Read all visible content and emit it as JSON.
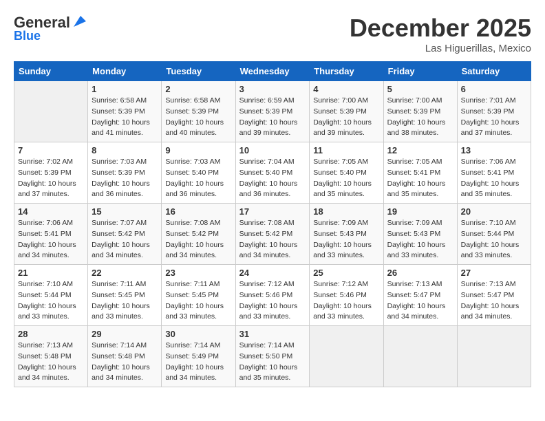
{
  "header": {
    "logo_general": "General",
    "logo_blue": "Blue",
    "month": "December 2025",
    "location": "Las Higuerillas, Mexico"
  },
  "days_of_week": [
    "Sunday",
    "Monday",
    "Tuesday",
    "Wednesday",
    "Thursday",
    "Friday",
    "Saturday"
  ],
  "weeks": [
    [
      {
        "day": "",
        "info": ""
      },
      {
        "day": "1",
        "info": "Sunrise: 6:58 AM\nSunset: 5:39 PM\nDaylight: 10 hours\nand 41 minutes."
      },
      {
        "day": "2",
        "info": "Sunrise: 6:58 AM\nSunset: 5:39 PM\nDaylight: 10 hours\nand 40 minutes."
      },
      {
        "day": "3",
        "info": "Sunrise: 6:59 AM\nSunset: 5:39 PM\nDaylight: 10 hours\nand 39 minutes."
      },
      {
        "day": "4",
        "info": "Sunrise: 7:00 AM\nSunset: 5:39 PM\nDaylight: 10 hours\nand 39 minutes."
      },
      {
        "day": "5",
        "info": "Sunrise: 7:00 AM\nSunset: 5:39 PM\nDaylight: 10 hours\nand 38 minutes."
      },
      {
        "day": "6",
        "info": "Sunrise: 7:01 AM\nSunset: 5:39 PM\nDaylight: 10 hours\nand 37 minutes."
      }
    ],
    [
      {
        "day": "7",
        "info": "Sunrise: 7:02 AM\nSunset: 5:39 PM\nDaylight: 10 hours\nand 37 minutes."
      },
      {
        "day": "8",
        "info": "Sunrise: 7:03 AM\nSunset: 5:39 PM\nDaylight: 10 hours\nand 36 minutes."
      },
      {
        "day": "9",
        "info": "Sunrise: 7:03 AM\nSunset: 5:40 PM\nDaylight: 10 hours\nand 36 minutes."
      },
      {
        "day": "10",
        "info": "Sunrise: 7:04 AM\nSunset: 5:40 PM\nDaylight: 10 hours\nand 36 minutes."
      },
      {
        "day": "11",
        "info": "Sunrise: 7:05 AM\nSunset: 5:40 PM\nDaylight: 10 hours\nand 35 minutes."
      },
      {
        "day": "12",
        "info": "Sunrise: 7:05 AM\nSunset: 5:41 PM\nDaylight: 10 hours\nand 35 minutes."
      },
      {
        "day": "13",
        "info": "Sunrise: 7:06 AM\nSunset: 5:41 PM\nDaylight: 10 hours\nand 35 minutes."
      }
    ],
    [
      {
        "day": "14",
        "info": "Sunrise: 7:06 AM\nSunset: 5:41 PM\nDaylight: 10 hours\nand 34 minutes."
      },
      {
        "day": "15",
        "info": "Sunrise: 7:07 AM\nSunset: 5:42 PM\nDaylight: 10 hours\nand 34 minutes."
      },
      {
        "day": "16",
        "info": "Sunrise: 7:08 AM\nSunset: 5:42 PM\nDaylight: 10 hours\nand 34 minutes."
      },
      {
        "day": "17",
        "info": "Sunrise: 7:08 AM\nSunset: 5:42 PM\nDaylight: 10 hours\nand 34 minutes."
      },
      {
        "day": "18",
        "info": "Sunrise: 7:09 AM\nSunset: 5:43 PM\nDaylight: 10 hours\nand 33 minutes."
      },
      {
        "day": "19",
        "info": "Sunrise: 7:09 AM\nSunset: 5:43 PM\nDaylight: 10 hours\nand 33 minutes."
      },
      {
        "day": "20",
        "info": "Sunrise: 7:10 AM\nSunset: 5:44 PM\nDaylight: 10 hours\nand 33 minutes."
      }
    ],
    [
      {
        "day": "21",
        "info": "Sunrise: 7:10 AM\nSunset: 5:44 PM\nDaylight: 10 hours\nand 33 minutes."
      },
      {
        "day": "22",
        "info": "Sunrise: 7:11 AM\nSunset: 5:45 PM\nDaylight: 10 hours\nand 33 minutes."
      },
      {
        "day": "23",
        "info": "Sunrise: 7:11 AM\nSunset: 5:45 PM\nDaylight: 10 hours\nand 33 minutes."
      },
      {
        "day": "24",
        "info": "Sunrise: 7:12 AM\nSunset: 5:46 PM\nDaylight: 10 hours\nand 33 minutes."
      },
      {
        "day": "25",
        "info": "Sunrise: 7:12 AM\nSunset: 5:46 PM\nDaylight: 10 hours\nand 33 minutes."
      },
      {
        "day": "26",
        "info": "Sunrise: 7:13 AM\nSunset: 5:47 PM\nDaylight: 10 hours\nand 34 minutes."
      },
      {
        "day": "27",
        "info": "Sunrise: 7:13 AM\nSunset: 5:47 PM\nDaylight: 10 hours\nand 34 minutes."
      }
    ],
    [
      {
        "day": "28",
        "info": "Sunrise: 7:13 AM\nSunset: 5:48 PM\nDaylight: 10 hours\nand 34 minutes."
      },
      {
        "day": "29",
        "info": "Sunrise: 7:14 AM\nSunset: 5:48 PM\nDaylight: 10 hours\nand 34 minutes."
      },
      {
        "day": "30",
        "info": "Sunrise: 7:14 AM\nSunset: 5:49 PM\nDaylight: 10 hours\nand 34 minutes."
      },
      {
        "day": "31",
        "info": "Sunrise: 7:14 AM\nSunset: 5:50 PM\nDaylight: 10 hours\nand 35 minutes."
      },
      {
        "day": "",
        "info": ""
      },
      {
        "day": "",
        "info": ""
      },
      {
        "day": "",
        "info": ""
      }
    ]
  ]
}
